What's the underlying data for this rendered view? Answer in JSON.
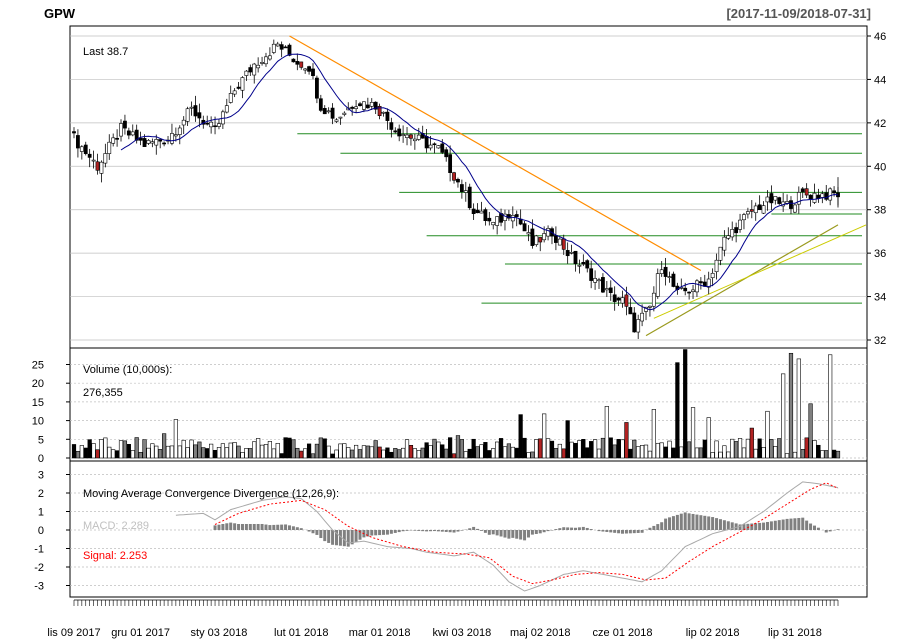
{
  "header": {
    "symbol": "GPW",
    "range": "[2017-11-09/2018-07-31]"
  },
  "colors": {
    "up": "#ffffff",
    "down": "#000000",
    "down_neg": "#b22222",
    "ma_line": "#00008b",
    "trend_orange": "#ff8c00",
    "trend_olive": "#9a9a1e",
    "level_green": "#228b22",
    "macd_line": "#a9a9a9",
    "signal_line": "#ff0000",
    "grid": "#bfbfbf",
    "hist": "#808080"
  },
  "chart_data": [
    {
      "panel": "price",
      "type": "candlestick",
      "annotation": "Last 38.7",
      "ylim": [
        32,
        46
      ],
      "yticks": [
        32,
        34,
        36,
        38,
        40,
        42,
        44,
        46
      ],
      "anchors": [
        {
          "i": 0,
          "v": 41.3
        },
        {
          "i": 6,
          "v": 40.0
        },
        {
          "i": 12,
          "v": 41.7
        },
        {
          "i": 18,
          "v": 41.0
        },
        {
          "i": 24,
          "v": 41.3
        },
        {
          "i": 30,
          "v": 42.6
        },
        {
          "i": 36,
          "v": 41.6
        },
        {
          "i": 41,
          "v": 43.5
        },
        {
          "i": 46,
          "v": 44.7
        },
        {
          "i": 52,
          "v": 45.6
        },
        {
          "i": 57,
          "v": 44.8
        },
        {
          "i": 60,
          "v": 44.6
        },
        {
          "i": 63,
          "v": 42.8
        },
        {
          "i": 67,
          "v": 42.2
        },
        {
          "i": 72,
          "v": 43.0
        },
        {
          "i": 77,
          "v": 42.8
        },
        {
          "i": 82,
          "v": 41.7
        },
        {
          "i": 88,
          "v": 41.2
        },
        {
          "i": 93,
          "v": 40.8
        },
        {
          "i": 97,
          "v": 39.6
        },
        {
          "i": 102,
          "v": 38.0
        },
        {
          "i": 107,
          "v": 37.3
        },
        {
          "i": 112,
          "v": 38.0
        },
        {
          "i": 117,
          "v": 36.4
        },
        {
          "i": 122,
          "v": 37.0
        },
        {
          "i": 127,
          "v": 35.8
        },
        {
          "i": 132,
          "v": 35.0
        },
        {
          "i": 137,
          "v": 34.0
        },
        {
          "i": 140,
          "v": 33.8
        },
        {
          "i": 143,
          "v": 32.6
        },
        {
          "i": 147,
          "v": 33.5
        },
        {
          "i": 150,
          "v": 35.5
        },
        {
          "i": 154,
          "v": 34.1
        },
        {
          "i": 158,
          "v": 34.4
        },
        {
          "i": 162,
          "v": 34.8
        },
        {
          "i": 166,
          "v": 36.6
        },
        {
          "i": 170,
          "v": 37.4
        },
        {
          "i": 174,
          "v": 38.1
        },
        {
          "i": 178,
          "v": 38.4
        },
        {
          "i": 182,
          "v": 38.2
        },
        {
          "i": 186,
          "v": 38.7
        }
      ],
      "levels": [
        41.5,
        40.6,
        38.8,
        37.8,
        36.8,
        35.5,
        33.7
      ],
      "trendlines": [
        {
          "name": "down",
          "from": {
            "i": 55,
            "v": 46.0
          },
          "to": {
            "i": 160,
            "v": 35.2
          }
        },
        {
          "name": "up",
          "from": {
            "i": 146,
            "v": 32.2
          },
          "to": {
            "i": 195,
            "v": 37.3
          }
        }
      ]
    },
    {
      "panel": "volume",
      "type": "bar",
      "label": "Volume (10,000s):",
      "last_value": "276,355",
      "ylim": [
        0,
        27
      ],
      "yticks": [
        0,
        5,
        10,
        15,
        20,
        25
      ],
      "spikes": [
        {
          "i": 23,
          "v": 6.5
        },
        {
          "i": 26,
          "v": 10.3
        },
        {
          "i": 98,
          "v": 6.0
        },
        {
          "i": 114,
          "v": 11.6
        },
        {
          "i": 120,
          "v": 11.8
        },
        {
          "i": 126,
          "v": 10.0
        },
        {
          "i": 136,
          "v": 13.8
        },
        {
          "i": 141,
          "v": 9.5
        },
        {
          "i": 148,
          "v": 13.0
        },
        {
          "i": 154,
          "v": 25.5
        },
        {
          "i": 156,
          "v": 29.0
        },
        {
          "i": 158,
          "v": 13.5
        },
        {
          "i": 162,
          "v": 10.8
        },
        {
          "i": 173,
          "v": 8.0
        },
        {
          "i": 177,
          "v": 12.5
        },
        {
          "i": 181,
          "v": 22.5
        },
        {
          "i": 183,
          "v": 28.0
        },
        {
          "i": 185,
          "v": 26.5
        },
        {
          "i": 188,
          "v": 14.5
        },
        {
          "i": 193,
          "v": 27.6
        }
      ]
    },
    {
      "panel": "macd",
      "type": "line",
      "label": "Moving Average Convergence Divergence (12,26,9):",
      "macd_label": "MACD: 2.289",
      "signal_label": "Signal: 2.253",
      "ylim": [
        -3.6,
        3.3
      ],
      "yticks": [
        -3,
        -2,
        -1,
        0,
        1,
        2,
        3
      ],
      "macd": [
        {
          "i": 26,
          "v": 0.8
        },
        {
          "i": 33,
          "v": 0.9
        },
        {
          "i": 36,
          "v": 0.55
        },
        {
          "i": 40,
          "v": 1.1
        },
        {
          "i": 48,
          "v": 1.6
        },
        {
          "i": 54,
          "v": 1.8
        },
        {
          "i": 58,
          "v": 1.7
        },
        {
          "i": 62,
          "v": 1.0
        },
        {
          "i": 66,
          "v": 0.0
        },
        {
          "i": 70,
          "v": -0.7
        },
        {
          "i": 74,
          "v": -0.6
        },
        {
          "i": 80,
          "v": -0.9
        },
        {
          "i": 86,
          "v": -1.0
        },
        {
          "i": 90,
          "v": -1.2
        },
        {
          "i": 97,
          "v": -1.4
        },
        {
          "i": 102,
          "v": -1.2
        },
        {
          "i": 107,
          "v": -1.9
        },
        {
          "i": 111,
          "v": -2.8
        },
        {
          "i": 115,
          "v": -3.3
        },
        {
          "i": 119,
          "v": -3.0
        },
        {
          "i": 125,
          "v": -2.4
        },
        {
          "i": 130,
          "v": -2.2
        },
        {
          "i": 135,
          "v": -2.4
        },
        {
          "i": 140,
          "v": -2.6
        },
        {
          "i": 145,
          "v": -2.8
        },
        {
          "i": 150,
          "v": -2.2
        },
        {
          "i": 156,
          "v": -0.9
        },
        {
          "i": 163,
          "v": -0.2
        },
        {
          "i": 170,
          "v": 0.2
        },
        {
          "i": 176,
          "v": 1.0
        },
        {
          "i": 182,
          "v": 2.0
        },
        {
          "i": 186,
          "v": 2.6
        },
        {
          "i": 190,
          "v": 2.5
        },
        {
          "i": 195,
          "v": 2.29
        }
      ],
      "signal": [
        {
          "i": 36,
          "v": 0.3
        },
        {
          "i": 42,
          "v": 0.9
        },
        {
          "i": 50,
          "v": 1.4
        },
        {
          "i": 58,
          "v": 1.6
        },
        {
          "i": 64,
          "v": 1.1
        },
        {
          "i": 70,
          "v": 0.2
        },
        {
          "i": 76,
          "v": -0.4
        },
        {
          "i": 84,
          "v": -0.9
        },
        {
          "i": 92,
          "v": -1.2
        },
        {
          "i": 100,
          "v": -1.3
        },
        {
          "i": 106,
          "v": -1.5
        },
        {
          "i": 112,
          "v": -2.5
        },
        {
          "i": 117,
          "v": -2.9
        },
        {
          "i": 122,
          "v": -2.7
        },
        {
          "i": 128,
          "v": -2.4
        },
        {
          "i": 134,
          "v": -2.3
        },
        {
          "i": 140,
          "v": -2.4
        },
        {
          "i": 146,
          "v": -2.7
        },
        {
          "i": 151,
          "v": -2.6
        },
        {
          "i": 157,
          "v": -1.7
        },
        {
          "i": 163,
          "v": -0.9
        },
        {
          "i": 170,
          "v": -0.1
        },
        {
          "i": 176,
          "v": 0.6
        },
        {
          "i": 182,
          "v": 1.4
        },
        {
          "i": 188,
          "v": 2.2
        },
        {
          "i": 192,
          "v": 2.55
        },
        {
          "i": 195,
          "v": 2.25
        }
      ]
    }
  ],
  "x_axis": {
    "n_bars": 196,
    "labels": [
      {
        "i": 0,
        "label": "lis 09 2017"
      },
      {
        "i": 17,
        "label": "gru 01 2017"
      },
      {
        "i": 37,
        "label": "sty 03 2018"
      },
      {
        "i": 58,
        "label": "lut 01 2018"
      },
      {
        "i": 78,
        "label": "mar 01 2018"
      },
      {
        "i": 99,
        "label": "kwi 03 2018"
      },
      {
        "i": 119,
        "label": "maj 02 2018"
      },
      {
        "i": 140,
        "label": "cze 01 2018"
      },
      {
        "i": 163,
        "label": "lip 02 2018"
      },
      {
        "i": 184,
        "label": "lip 31 2018"
      }
    ]
  }
}
